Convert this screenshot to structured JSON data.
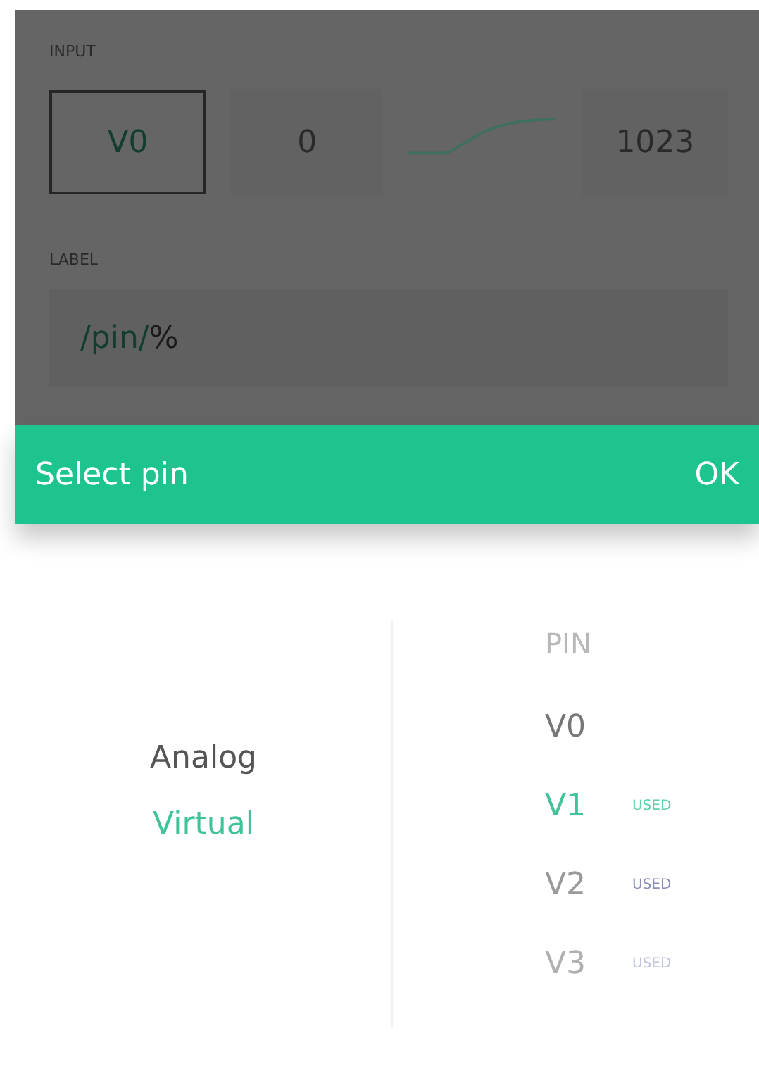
{
  "settings": {
    "input_label": "INPUT",
    "pin": {
      "value": "V0",
      "selected": true
    },
    "min": "0",
    "max": "1023",
    "label_label": "LABEL",
    "label_field": {
      "parts": [
        {
          "text": "/pin/",
          "kind": "tag"
        },
        {
          "text": "%",
          "kind": "plain"
        }
      ]
    }
  },
  "header": {
    "title": "Select pin",
    "ok": "OK"
  },
  "types": [
    {
      "label": "Analog",
      "selected": false
    },
    {
      "label": "Virtual",
      "selected": true
    }
  ],
  "pin_column": {
    "heading": "PIN",
    "pins": [
      {
        "label": "V0",
        "selected": false
      },
      {
        "label": "V1",
        "selected": true,
        "badge": "USED"
      },
      {
        "label": "V2",
        "selected": false,
        "badge": "USED"
      },
      {
        "label": "V3",
        "selected": false,
        "badge": "USED"
      }
    ]
  }
}
